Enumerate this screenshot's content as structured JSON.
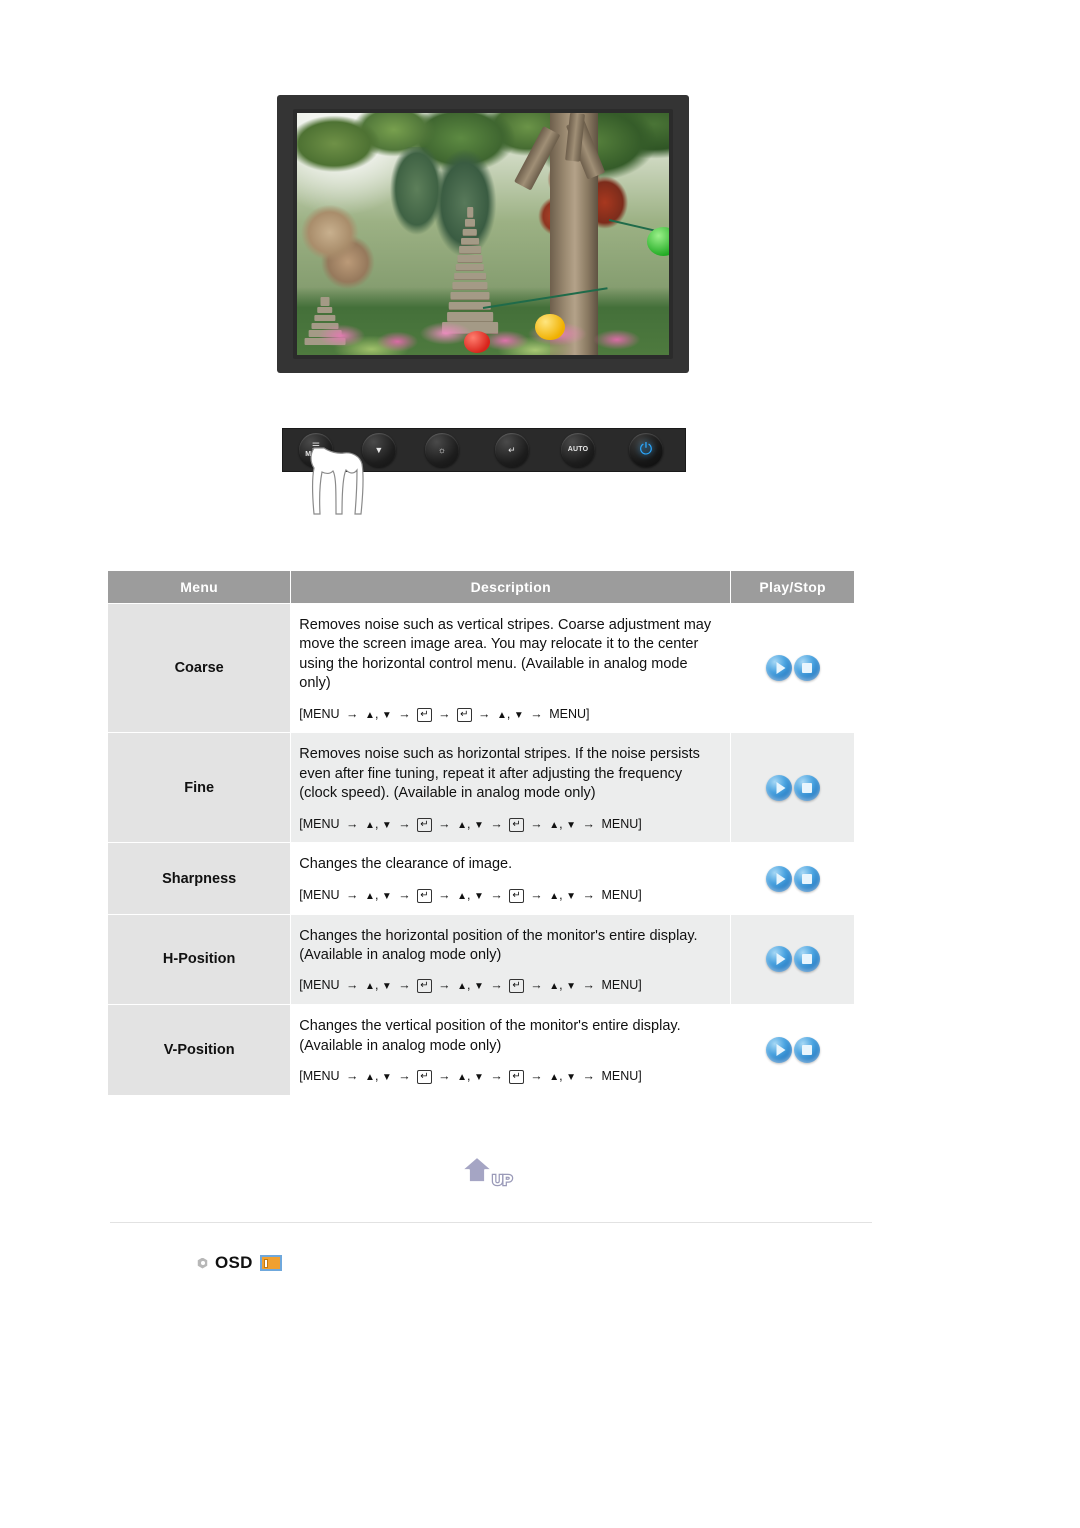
{
  "monitor": {
    "scene_alt": "garden-with-stone-pagoda-and-lanterns",
    "control_panel": {
      "buttons": [
        {
          "name": "menu-button",
          "caption": "MENU",
          "glyph": "☰"
        },
        {
          "name": "down-button",
          "caption": "",
          "glyph": "▼"
        },
        {
          "name": "brightness-button",
          "caption": "",
          "glyph": "※"
        },
        {
          "name": "enter-button",
          "caption": "",
          "glyph": "↵"
        },
        {
          "name": "auto-button",
          "caption": "AUTO",
          "glyph": ""
        },
        {
          "name": "power-button",
          "caption": "",
          "glyph": "⏻"
        }
      ]
    }
  },
  "table": {
    "headers": {
      "menu": "Menu",
      "description": "Description",
      "playstop": "Play/Stop"
    },
    "rows": [
      {
        "menu": "Coarse",
        "description": "Removes noise such as vertical stripes. Coarse adjustment may move the screen image area. You may relocate it to the center using the horizontal control menu. (Available in analog mode only)",
        "sequence_type": "short",
        "sequence_text": "[MENU → ▲, ▼ → ↵ → ↵ → ▲, ▼ → MENU]",
        "shaded": false,
        "play_label": "play-button",
        "stop_label": "stop-button"
      },
      {
        "menu": "Fine",
        "description": "Removes noise such as horizontal stripes. If the noise persists even after fine tuning, repeat it after adjusting the frequency (clock speed). (Available in analog mode only)",
        "sequence_type": "long",
        "sequence_text": "[MENU → ▲, ▼ → ↵ → ▲, ▼ → ↵ → ▲, ▼ → MENU]",
        "shaded": true,
        "play_label": "play-button",
        "stop_label": "stop-button"
      },
      {
        "menu": "Sharpness",
        "description": "Changes the clearance of image.",
        "sequence_type": "long",
        "sequence_text": "[MENU → ▲, ▼ → ↵ → ▲, ▼ → ↵ → ▲, ▼ → MENU]",
        "shaded": false,
        "play_label": "play-button",
        "stop_label": "stop-button"
      },
      {
        "menu": "H-Position",
        "description": "Changes the horizontal position of the monitor's entire display. (Available in analog mode only)",
        "sequence_type": "long",
        "sequence_text": "[MENU → ▲, ▼ → ↵ → ▲, ▼ → ↵ → ▲, ▼ → MENU]",
        "shaded": true,
        "play_label": "play-button",
        "stop_label": "stop-button"
      },
      {
        "menu": "V-Position",
        "description": "Changes the vertical position of the monitor's entire display. (Available in analog mode only)",
        "sequence_type": "long",
        "sequence_text": "[MENU → ▲, ▼ → ↵ → ▲, ▼ → ↵ → ▲, ▼ → MENU]",
        "shaded": false,
        "play_label": "play-button",
        "stop_label": "stop-button"
      }
    ]
  },
  "up_button": {
    "label": "UP"
  },
  "section": {
    "osd_label": "OSD"
  },
  "colors": {
    "header_bg": "#9c9c9c",
    "menu_cell_bg": "#e3e3e3",
    "row_shaded_bg": "#eceded",
    "table_border": "#b0b0b0",
    "bezel": "#343434",
    "panel": "#2a2a2a",
    "power_blue": "#2aa8ff",
    "play_blue": "#2f8ed2",
    "up_arrow": "#9a9ab8",
    "osd_icon_orange": "#f0a030",
    "osd_icon_border": "#6fa8dc",
    "divider": "#e2e2e2"
  }
}
